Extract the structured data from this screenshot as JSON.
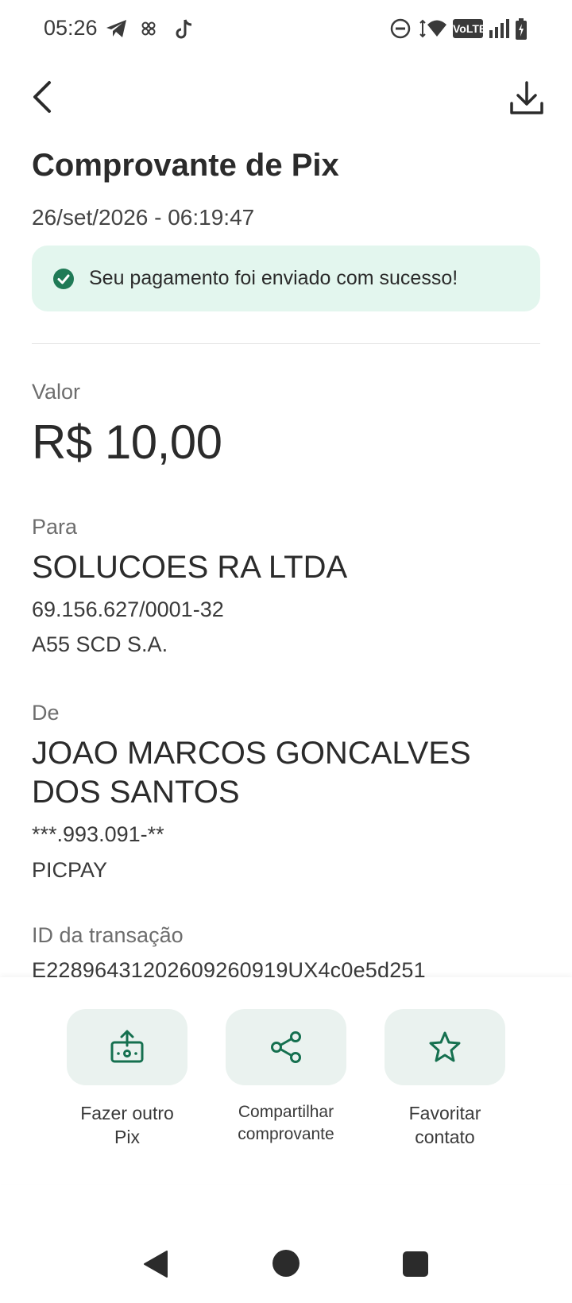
{
  "status_bar": {
    "time": "05:26",
    "network_badge": "VoLTE"
  },
  "header": {
    "title": "Comprovante de Pix",
    "timestamp": "26/set/2026 - 06:19:47"
  },
  "banner": {
    "message": "Seu pagamento foi enviado com sucesso!",
    "color": "#e3f6ee",
    "icon_color": "#1f7a56"
  },
  "valor": {
    "label": "Valor",
    "amount": "R$ 10,00"
  },
  "para": {
    "label": "Para",
    "name": "SOLUCOES RA LTDA",
    "document": "69.156.627/0001-32",
    "institution": "A55 SCD S.A."
  },
  "de": {
    "label": "De",
    "name": "JOAO MARCOS GONCALVES DOS SANTOS",
    "document": "***.993.091-**",
    "institution": "PICPAY"
  },
  "transaction": {
    "label": "ID da transação",
    "id": "E22896431202609260919UX4c0e5d251"
  },
  "actions": [
    {
      "label_line1": "Fazer outro",
      "label_line2": "Pix",
      "icon": "send-money-icon"
    },
    {
      "label_line1": "Compartilhar",
      "label_line2": "comprovante",
      "icon": "share-icon"
    },
    {
      "label_line1": "Favoritar",
      "label_line2": "contato",
      "icon": "star-icon"
    }
  ],
  "accent_color": "#15704f"
}
